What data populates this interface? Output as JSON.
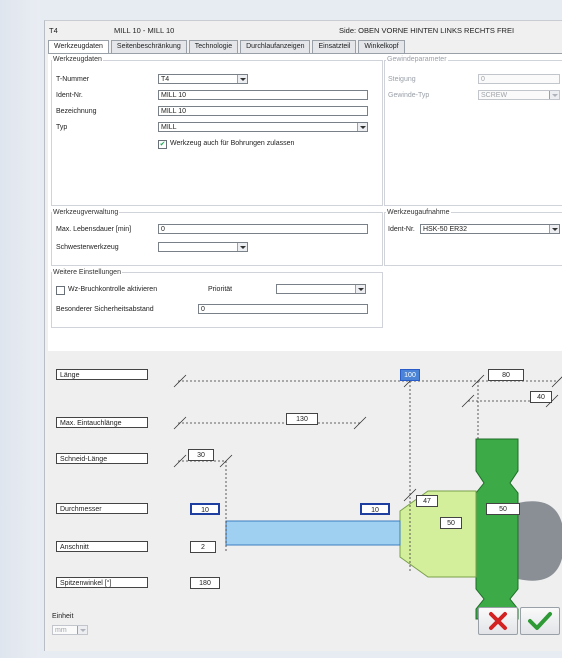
{
  "window": {
    "tool_id": "T4",
    "tool_name": "MILL 10 - MILL 10",
    "side_label": "Side: OBEN VORNE HINTEN LINKS RECHTS FREI"
  },
  "tabs": [
    {
      "label": "Werkzeugdaten",
      "active": true
    },
    {
      "label": "Seitenbeschränkung",
      "active": false
    },
    {
      "label": "Technologie",
      "active": false
    },
    {
      "label": "Durchlaufanzeigen",
      "active": false
    },
    {
      "label": "Einsatzteil",
      "active": false
    },
    {
      "label": "Winkelkopf",
      "active": false
    }
  ],
  "tool_data": {
    "title": "Werkzeugdaten",
    "t_number_label": "T-Nummer",
    "t_number_value": "T4",
    "ident_label": "Ident-Nr.",
    "ident_value": "MILL 10",
    "name_label": "Bezeichnung",
    "name_value": "MILL 10",
    "type_label": "Typ",
    "type_value": "MILL",
    "allow_drilling_label": "Werkzeug auch für Bohrungen zulassen",
    "allow_drilling_checked": true
  },
  "thread_params": {
    "title": "Gewindeparameter",
    "pitch_label": "Steigung",
    "pitch_value": "0",
    "thread_type_label": "Gewinde-Typ",
    "thread_type_value": "SCREW"
  },
  "tool_management": {
    "title": "Werkzeugverwaltung",
    "max_life_label": "Max. Lebensdauer [min]",
    "max_life_value": "0",
    "sister_tool_label": "Schwesterwerkzeug",
    "sister_tool_value": ""
  },
  "tool_holder": {
    "title": "Werkzeugaufnahme",
    "ident_label": "Ident-Nr.",
    "ident_value": "HSK-50 ER32"
  },
  "further_settings": {
    "title": "Weitere Einstellungen",
    "breakage_label": "Wz-Bruchkontrolle aktivieren",
    "breakage_checked": false,
    "priority_label": "Priorität",
    "priority_value": "",
    "safety_label": "Besonderer Sicherheitsabstand",
    "safety_value": "0"
  },
  "drawing": {
    "length_label": "Länge",
    "max_plunge_label": "Max. Eintauchlänge",
    "cutting_length_label": "Schneid-Länge",
    "diameter_label": "Durchmesser",
    "cuts_label": "Anschnitt",
    "tip_angle_label": "Spitzenwinkel [°]",
    "length_value": "100",
    "holder_length": "80",
    "holder_step": "40",
    "max_plunge_value": "130",
    "cutting_length_value": "30",
    "diameter_value": "10",
    "shank_diameter": "10",
    "cone_diameter_small": "47",
    "cone_diameter_large": "50",
    "flange_diameter": "50",
    "cuts_value": "2",
    "tip_angle_value": "180"
  },
  "footer": {
    "unit_label": "Einheit",
    "unit_value": "mm"
  },
  "colors": {
    "shank_fill": "#9fd0f2",
    "cone_fill": "#d4ef9c",
    "flange_fill": "#3caa46",
    "spindle_fill": "#8a8f96",
    "cancel_icon": "#d42121",
    "ok_icon": "#2e9a35"
  },
  "icons": {
    "cancel": "cross-icon",
    "ok": "checkmark-icon"
  }
}
